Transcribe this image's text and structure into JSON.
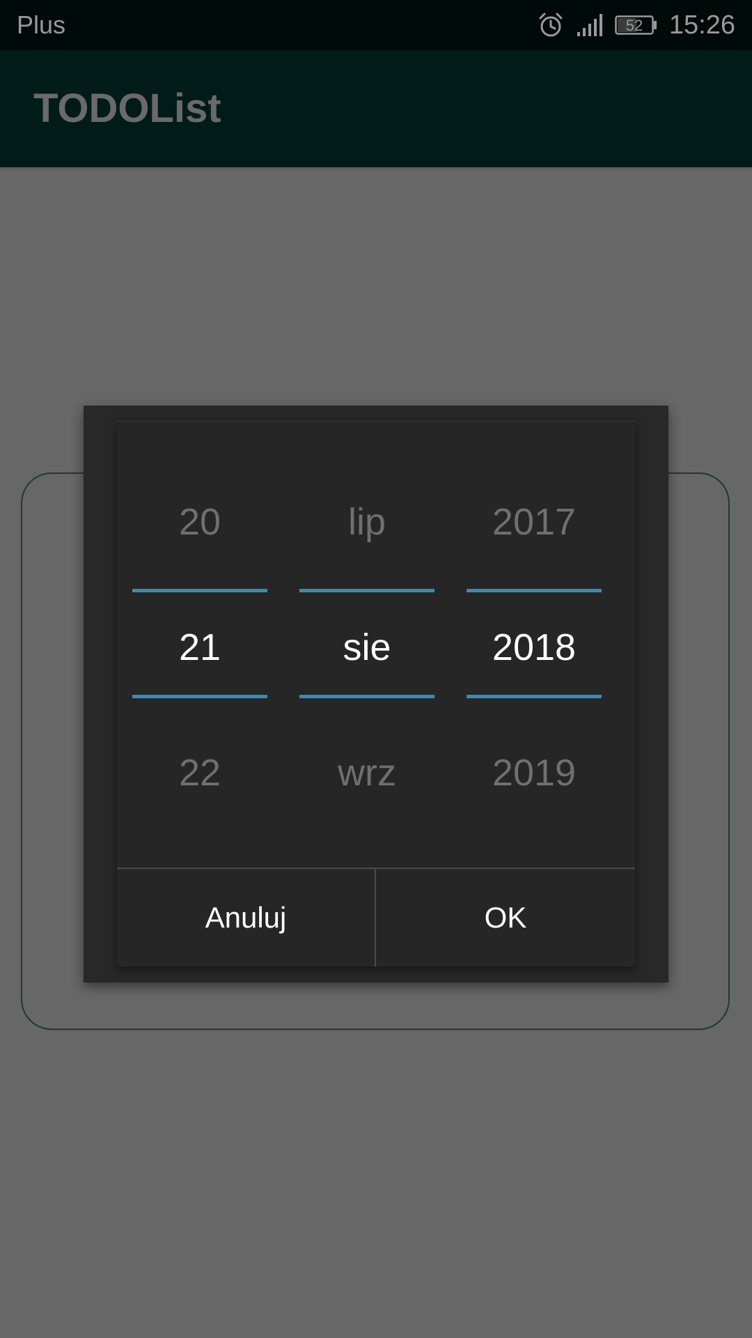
{
  "status_bar": {
    "carrier": "Plus",
    "battery_level": "52",
    "time": "15:26",
    "icons": [
      "alarm-icon",
      "signal-icon",
      "battery-icon"
    ]
  },
  "app_bar": {
    "title": "TODOList"
  },
  "date_picker": {
    "day": {
      "previous": "20",
      "selected": "21",
      "next": "22"
    },
    "month": {
      "previous": "lip",
      "selected": "sie",
      "next": "wrz"
    },
    "year": {
      "previous": "2017",
      "selected": "2018",
      "next": "2019"
    },
    "cancel_label": "Anuluj",
    "ok_label": "OK"
  },
  "colors": {
    "scrim": "#676767",
    "status_bar_bg": "#000a08",
    "app_bar_bg": "#011c18",
    "dialog_bg": "#262626",
    "accent_divider": "#3a8cb0",
    "card_border": "#1e3a30"
  }
}
